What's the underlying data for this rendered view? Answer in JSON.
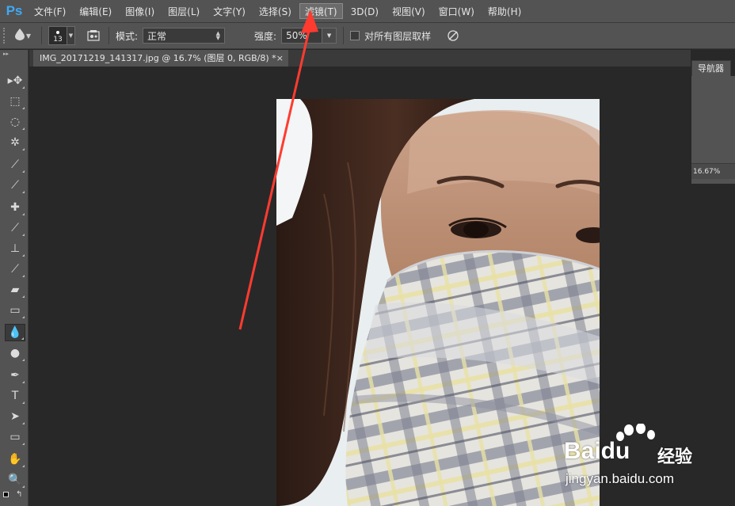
{
  "app": {
    "logo": "Ps"
  },
  "menu": {
    "items": [
      {
        "label": "文件(F)"
      },
      {
        "label": "编辑(E)"
      },
      {
        "label": "图像(I)"
      },
      {
        "label": "图层(L)"
      },
      {
        "label": "文字(Y)"
      },
      {
        "label": "选择(S)"
      },
      {
        "label": "滤镜(T)",
        "active": true
      },
      {
        "label": "3D(D)"
      },
      {
        "label": "视图(V)"
      },
      {
        "label": "窗口(W)"
      },
      {
        "label": "帮助(H)"
      }
    ]
  },
  "options": {
    "brush_size": "13",
    "mode_label": "模式:",
    "mode_value": "正常",
    "strength_label": "强度:",
    "strength_value": "50%",
    "sample_all_layers_label": "对所有图层取样",
    "sample_all_layers_checked": false
  },
  "tools": [
    {
      "name": "move-tool-icon",
      "glyph": "▸✥"
    },
    {
      "name": "marquee-tool-icon",
      "glyph": "⬚"
    },
    {
      "name": "lasso-tool-icon",
      "glyph": "◌"
    },
    {
      "name": "magic-wand-tool-icon",
      "glyph": "✲"
    },
    {
      "name": "crop-tool-icon",
      "glyph": "⟋"
    },
    {
      "name": "eyedropper-tool-icon",
      "glyph": "⟋"
    },
    {
      "name": "healing-brush-tool-icon",
      "glyph": "✚"
    },
    {
      "name": "brush-tool-icon",
      "glyph": "⟋"
    },
    {
      "name": "clone-stamp-tool-icon",
      "glyph": "⊥"
    },
    {
      "name": "history-brush-tool-icon",
      "glyph": "⟋"
    },
    {
      "name": "eraser-tool-icon",
      "glyph": "▰"
    },
    {
      "name": "gradient-tool-icon",
      "glyph": "▭"
    },
    {
      "name": "blur-tool-icon",
      "glyph": "💧",
      "active": true
    },
    {
      "name": "dodge-tool-icon",
      "glyph": "●"
    },
    {
      "name": "pen-tool-icon",
      "glyph": "✒"
    },
    {
      "name": "type-tool-icon",
      "glyph": "T"
    },
    {
      "name": "path-selection-tool-icon",
      "glyph": "➤"
    },
    {
      "name": "rectangle-tool-icon",
      "glyph": "▭"
    },
    {
      "name": "hand-tool-icon",
      "glyph": "✋"
    },
    {
      "name": "zoom-tool-icon",
      "glyph": "🔍"
    }
  ],
  "document": {
    "tab_title": "IMG_20171219_141317.jpg @ 16.7% (图层 0, RGB/8) *",
    "close_glyph": "×"
  },
  "navigator": {
    "tab_label": "导航器",
    "zoom": "16.67%"
  },
  "watermark": {
    "brand": "Baidu",
    "suffix": "经验",
    "url": "jingyan.baidu.com"
  },
  "colors": {
    "accent_logo": "#3fa9f5",
    "panel": "#535353",
    "workspace": "#282828",
    "annotation_arrow": "#ff3b30"
  }
}
